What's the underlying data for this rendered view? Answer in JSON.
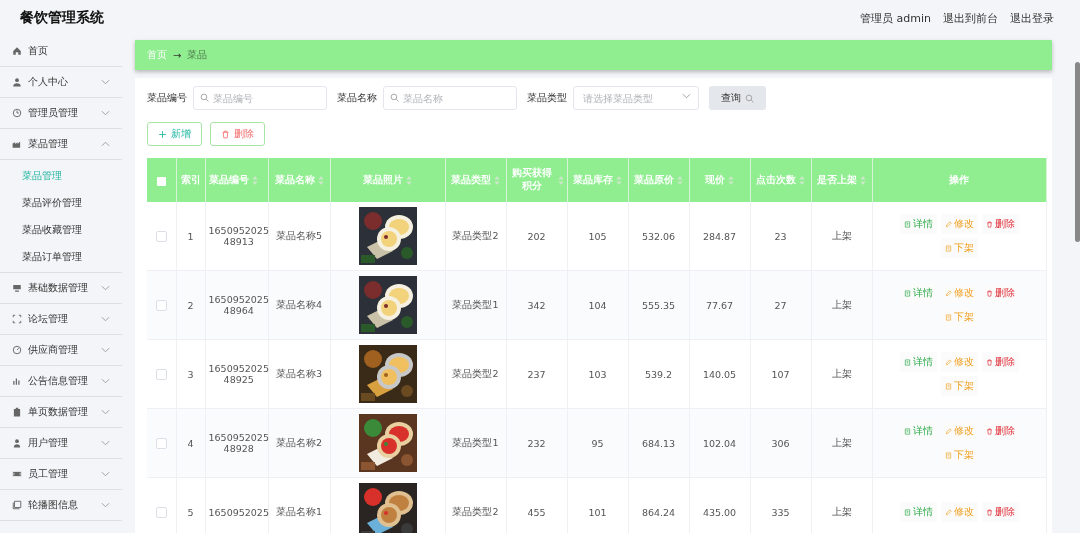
{
  "header": {
    "title": "餐饮管理系统",
    "links": [
      "管理员 admin",
      "退出到前台",
      "退出登录"
    ]
  },
  "sidebar": {
    "items": [
      {
        "label": "首页"
      },
      {
        "label": "个人中心",
        "expanded": false
      },
      {
        "label": "管理员管理",
        "expanded": false
      },
      {
        "label": "菜品管理",
        "expanded": true,
        "children": [
          {
            "label": "菜品管理",
            "selected": true
          },
          {
            "label": "菜品评价管理",
            "selected": false
          },
          {
            "label": "菜品收藏管理",
            "selected": false
          },
          {
            "label": "菜品订单管理",
            "selected": false
          }
        ]
      },
      {
        "label": "基础数据管理",
        "expanded": false
      },
      {
        "label": "论坛管理",
        "expanded": false
      },
      {
        "label": "供应商管理",
        "expanded": false
      },
      {
        "label": "公告信息管理",
        "expanded": false
      },
      {
        "label": "单页数据管理",
        "expanded": false
      },
      {
        "label": "用户管理",
        "expanded": false
      },
      {
        "label": "员工管理",
        "expanded": false
      },
      {
        "label": "轮播图信息",
        "expanded": false
      }
    ]
  },
  "breadcrumb": {
    "home": "首页",
    "separator": "→",
    "current": "菜品"
  },
  "filters": [
    {
      "kind": "text",
      "label": "菜品编号",
      "placeholder": "菜品编号"
    },
    {
      "kind": "text",
      "label": "菜品名称",
      "placeholder": "菜品名称"
    },
    {
      "kind": "select",
      "label": "菜品类型",
      "placeholder": "请选择菜品类型"
    }
  ],
  "query_button": "查询",
  "actions": [
    {
      "kind": "add",
      "label": "新增"
    },
    {
      "kind": "delete",
      "label": "删除"
    }
  ],
  "table": {
    "select_all": {
      "checked": false
    },
    "columns": [
      {
        "label": "索引",
        "sortable": false
      },
      {
        "label": "菜品编号",
        "sortable": true
      },
      {
        "label": "菜品名称",
        "sortable": true
      },
      {
        "label": "菜品照片",
        "sortable": true
      },
      {
        "label": "菜品类型",
        "sortable": true
      },
      {
        "label": "购买获得积分",
        "sortable": true
      },
      {
        "label": "菜品库存",
        "sortable": true
      },
      {
        "label": "菜品原价",
        "sortable": true
      },
      {
        "label": "现价",
        "sortable": true
      },
      {
        "label": "点击次数",
        "sortable": true
      },
      {
        "label": "是否上架",
        "sortable": true
      },
      {
        "label": "操作",
        "sortable": false
      }
    ],
    "rows": [
      {
        "checked": false,
        "index": "1",
        "code": [
          "1650952025",
          "48913"
        ],
        "name": "菜品名称5",
        "photo": {
          "kind": "picture"
        },
        "type": "菜品类型2",
        "points": "202",
        "stock": "105",
        "price": "532.06",
        "current": "284.87",
        "clicks": "23",
        "status": "上架",
        "ops": [
          {
            "kind": "detail",
            "label": "详情"
          },
          {
            "kind": "edit",
            "label": "修改"
          },
          {
            "kind": "delete",
            "label": "删除"
          },
          {
            "kind": "unlist",
            "label": "下架"
          }
        ]
      },
      {
        "checked": false,
        "index": "2",
        "code": [
          "1650952025",
          "48964"
        ],
        "name": "菜品名称4",
        "photo": {
          "kind": "picture"
        },
        "type": "菜品类型1",
        "points": "342",
        "stock": "104",
        "price": "555.35",
        "current": "77.67",
        "clicks": "27",
        "status": "上架",
        "ops": [
          {
            "kind": "detail",
            "label": "详情"
          },
          {
            "kind": "edit",
            "label": "修改"
          },
          {
            "kind": "delete",
            "label": "删除"
          },
          {
            "kind": "unlist",
            "label": "下架"
          }
        ]
      },
      {
        "checked": false,
        "index": "3",
        "code": [
          "1650952025",
          "48925"
        ],
        "name": "菜品名称3",
        "photo": {
          "kind": "picture"
        },
        "type": "菜品类型2",
        "points": "237",
        "stock": "103",
        "price": "539.2",
        "current": "140.05",
        "clicks": "107",
        "status": "上架",
        "ops": [
          {
            "kind": "detail",
            "label": "详情"
          },
          {
            "kind": "edit",
            "label": "修改"
          },
          {
            "kind": "delete",
            "label": "删除"
          },
          {
            "kind": "unlist",
            "label": "下架"
          }
        ]
      },
      {
        "checked": false,
        "index": "4",
        "code": [
          "1650952025",
          "48928"
        ],
        "name": "菜品名称2",
        "photo": {
          "kind": "picture"
        },
        "type": "菜品类型1",
        "points": "232",
        "stock": "95",
        "price": "684.13",
        "current": "102.04",
        "clicks": "306",
        "status": "上架",
        "ops": [
          {
            "kind": "detail",
            "label": "详情"
          },
          {
            "kind": "edit",
            "label": "修改"
          },
          {
            "kind": "delete",
            "label": "删除"
          },
          {
            "kind": "unlist",
            "label": "下架"
          }
        ]
      },
      {
        "checked": false,
        "index": "5",
        "code": [
          "1650952025"
        ],
        "name": "菜品名称1",
        "photo": {
          "kind": "picture"
        },
        "type": "菜品类型2",
        "points": "455",
        "stock": "101",
        "price": "864.24",
        "current": "435.00",
        "clicks": "335",
        "status": "上架",
        "ops": [
          {
            "kind": "detail",
            "label": "详情"
          },
          {
            "kind": "edit",
            "label": "修改"
          },
          {
            "kind": "delete",
            "label": "删除"
          }
        ]
      }
    ]
  }
}
